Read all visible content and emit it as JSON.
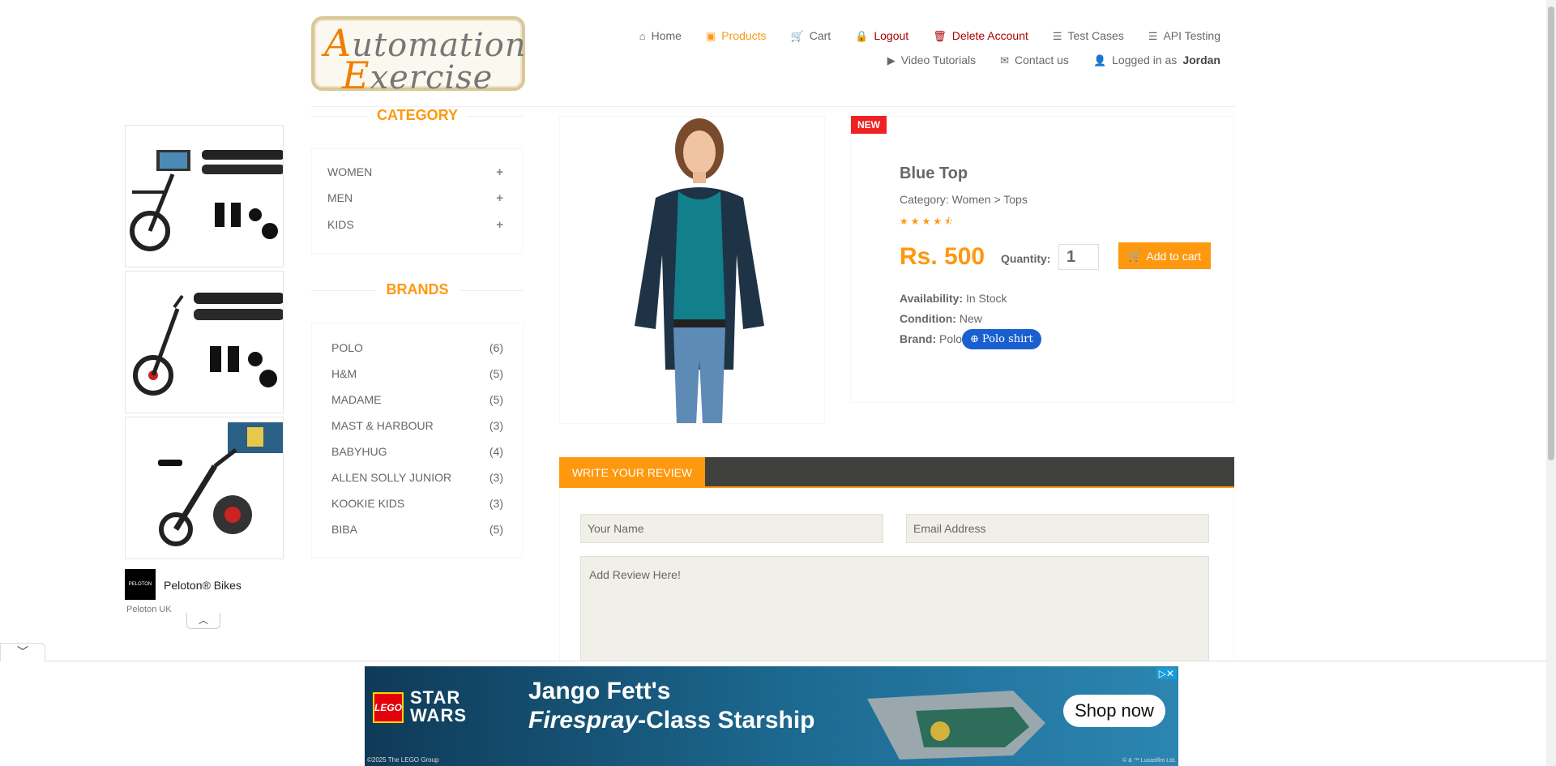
{
  "brand": {
    "logo_line1_cap": "A",
    "logo_line1": "utomation",
    "logo_line2_cap": "E",
    "logo_line2": "xercise"
  },
  "nav": {
    "row1": [
      {
        "icon": "home-icon",
        "glyph": "⌂",
        "label": "Home"
      },
      {
        "icon": "products-icon",
        "glyph": "▣",
        "label": "Products",
        "active": true
      },
      {
        "icon": "cart-icon",
        "glyph": "🛒",
        "label": "Cart"
      },
      {
        "icon": "lock-icon",
        "glyph": "🔒",
        "label": "Logout"
      },
      {
        "icon": "trash-icon",
        "glyph": "🗑",
        "label": "Delete Account"
      },
      {
        "icon": "list-icon",
        "glyph": "☰",
        "label": "Test Cases"
      },
      {
        "icon": "list-icon",
        "glyph": "☰",
        "label": "API Testing"
      }
    ],
    "row2": [
      {
        "icon": "youtube-icon",
        "glyph": "▶",
        "label": "Video Tutorials"
      },
      {
        "icon": "envelope-icon",
        "glyph": "✉",
        "label": "Contact us"
      },
      {
        "icon": "user-icon",
        "glyph": "👤",
        "label": "Logged in as",
        "user": "Jordan"
      }
    ]
  },
  "left_ad": {
    "title": "Peloton® Bikes",
    "sub": "Peloton UK",
    "logo_text": "PELOTON"
  },
  "sidebar": {
    "category_title": "CATEGORY",
    "categories": [
      "WOMEN",
      "MEN",
      "KIDS"
    ],
    "brands_title": "BRANDS",
    "brands": [
      {
        "name": "POLO",
        "count": "(6)"
      },
      {
        "name": "H&M",
        "count": "(5)"
      },
      {
        "name": "MADAME",
        "count": "(5)"
      },
      {
        "name": "MAST & HARBOUR",
        "count": "(3)"
      },
      {
        "name": "BABYHUG",
        "count": "(4)"
      },
      {
        "name": "ALLEN SOLLY JUNIOR",
        "count": "(3)"
      },
      {
        "name": "KOOKIE KIDS",
        "count": "(3)"
      },
      {
        "name": "BIBA",
        "count": "(5)"
      }
    ]
  },
  "product": {
    "badge": "NEW",
    "name": "Blue Top",
    "category": "Category: Women > Tops",
    "rating": 4.5,
    "stars": "★★★★⯪",
    "price": "Rs. 500",
    "quantity_label": "Quantity:",
    "quantity": "1",
    "add_to_cart": "Add to cart",
    "availability_label": "Availability:",
    "availability": " In Stock",
    "condition_label": "Condition:",
    "condition": " New",
    "brand_label": "Brand:",
    "brand": " Polo",
    "polo_pill": "Polo shirt"
  },
  "review": {
    "tab": "WRITE YOUR REVIEW",
    "name_placeholder": "Your Name",
    "email_placeholder": "Email Address",
    "review_placeholder": "Add Review Here!"
  },
  "bottom_ad": {
    "lego": "LEGO",
    "star_wars_1": "STAR",
    "star_wars_2": "WARS",
    "headline1": "Jango Fett's",
    "headline2_italic": "Firespray",
    "headline2_rest": "-Class Starship",
    "cta": "Shop now",
    "copyright": "©2025 The LEGO Group",
    "lucasfilm": "© & ™ Lucasfilm Ltd."
  },
  "colors": {
    "accent": "#fe980f",
    "danger": "#aa0000",
    "review_bar": "#40403e",
    "pill": "#1a5fd0"
  }
}
